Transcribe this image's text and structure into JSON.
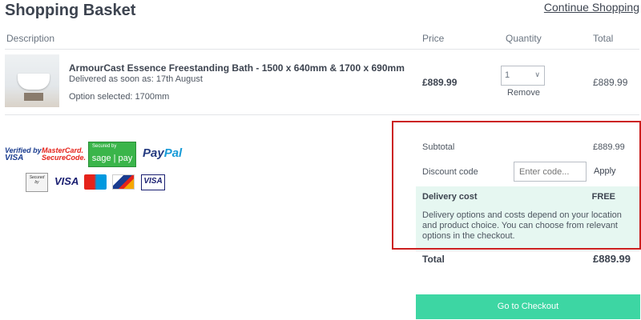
{
  "header": {
    "title": "Shopping Basket",
    "continue_link": "Continue Shopping"
  },
  "table": {
    "columns": [
      "Description",
      "Price",
      "Quantity",
      "Total"
    ]
  },
  "item": {
    "name": "ArmourCast Essence Freestanding Bath - 1500 x 640mm & 1700 x 690mm",
    "delivery": "Delivered as soon as: 17th August",
    "option": "Option selected: 1700mm",
    "price": "£889.99",
    "quantity": "1",
    "remove_label": "Remove",
    "total": "£889.99"
  },
  "payment_logos": {
    "verified_visa_line1": "Verified by",
    "verified_visa_line2": "VISA",
    "mastercard_line1": "MasterCard.",
    "mastercard_line2": "SecureCode.",
    "sage_secured": "Secured by",
    "sage_pay": "sage | pay",
    "paypal_a": "Pay",
    "paypal_b": "Pal",
    "secured_by_line1": "Secured",
    "secured_by_line2": "by",
    "visa": "VISA",
    "visa_electron": "VISA"
  },
  "summary": {
    "subtotal_label": "Subtotal",
    "subtotal_value": "£889.99",
    "discount_label": "Discount code",
    "discount_placeholder": "Enter code...",
    "apply_label": "Apply",
    "delivery_label": "Delivery cost",
    "delivery_value": "FREE",
    "delivery_note": "Delivery options and costs depend on your location and product choice. You can choose from relevant options in the checkout.",
    "total_label": "Total",
    "total_value": "£889.99"
  },
  "checkout_label": "Go to Checkout",
  "colors": {
    "accent_green": "#3dd6a3",
    "highlight_red": "#cc1f1f",
    "delivery_panel_bg": "#e6f7f1"
  }
}
